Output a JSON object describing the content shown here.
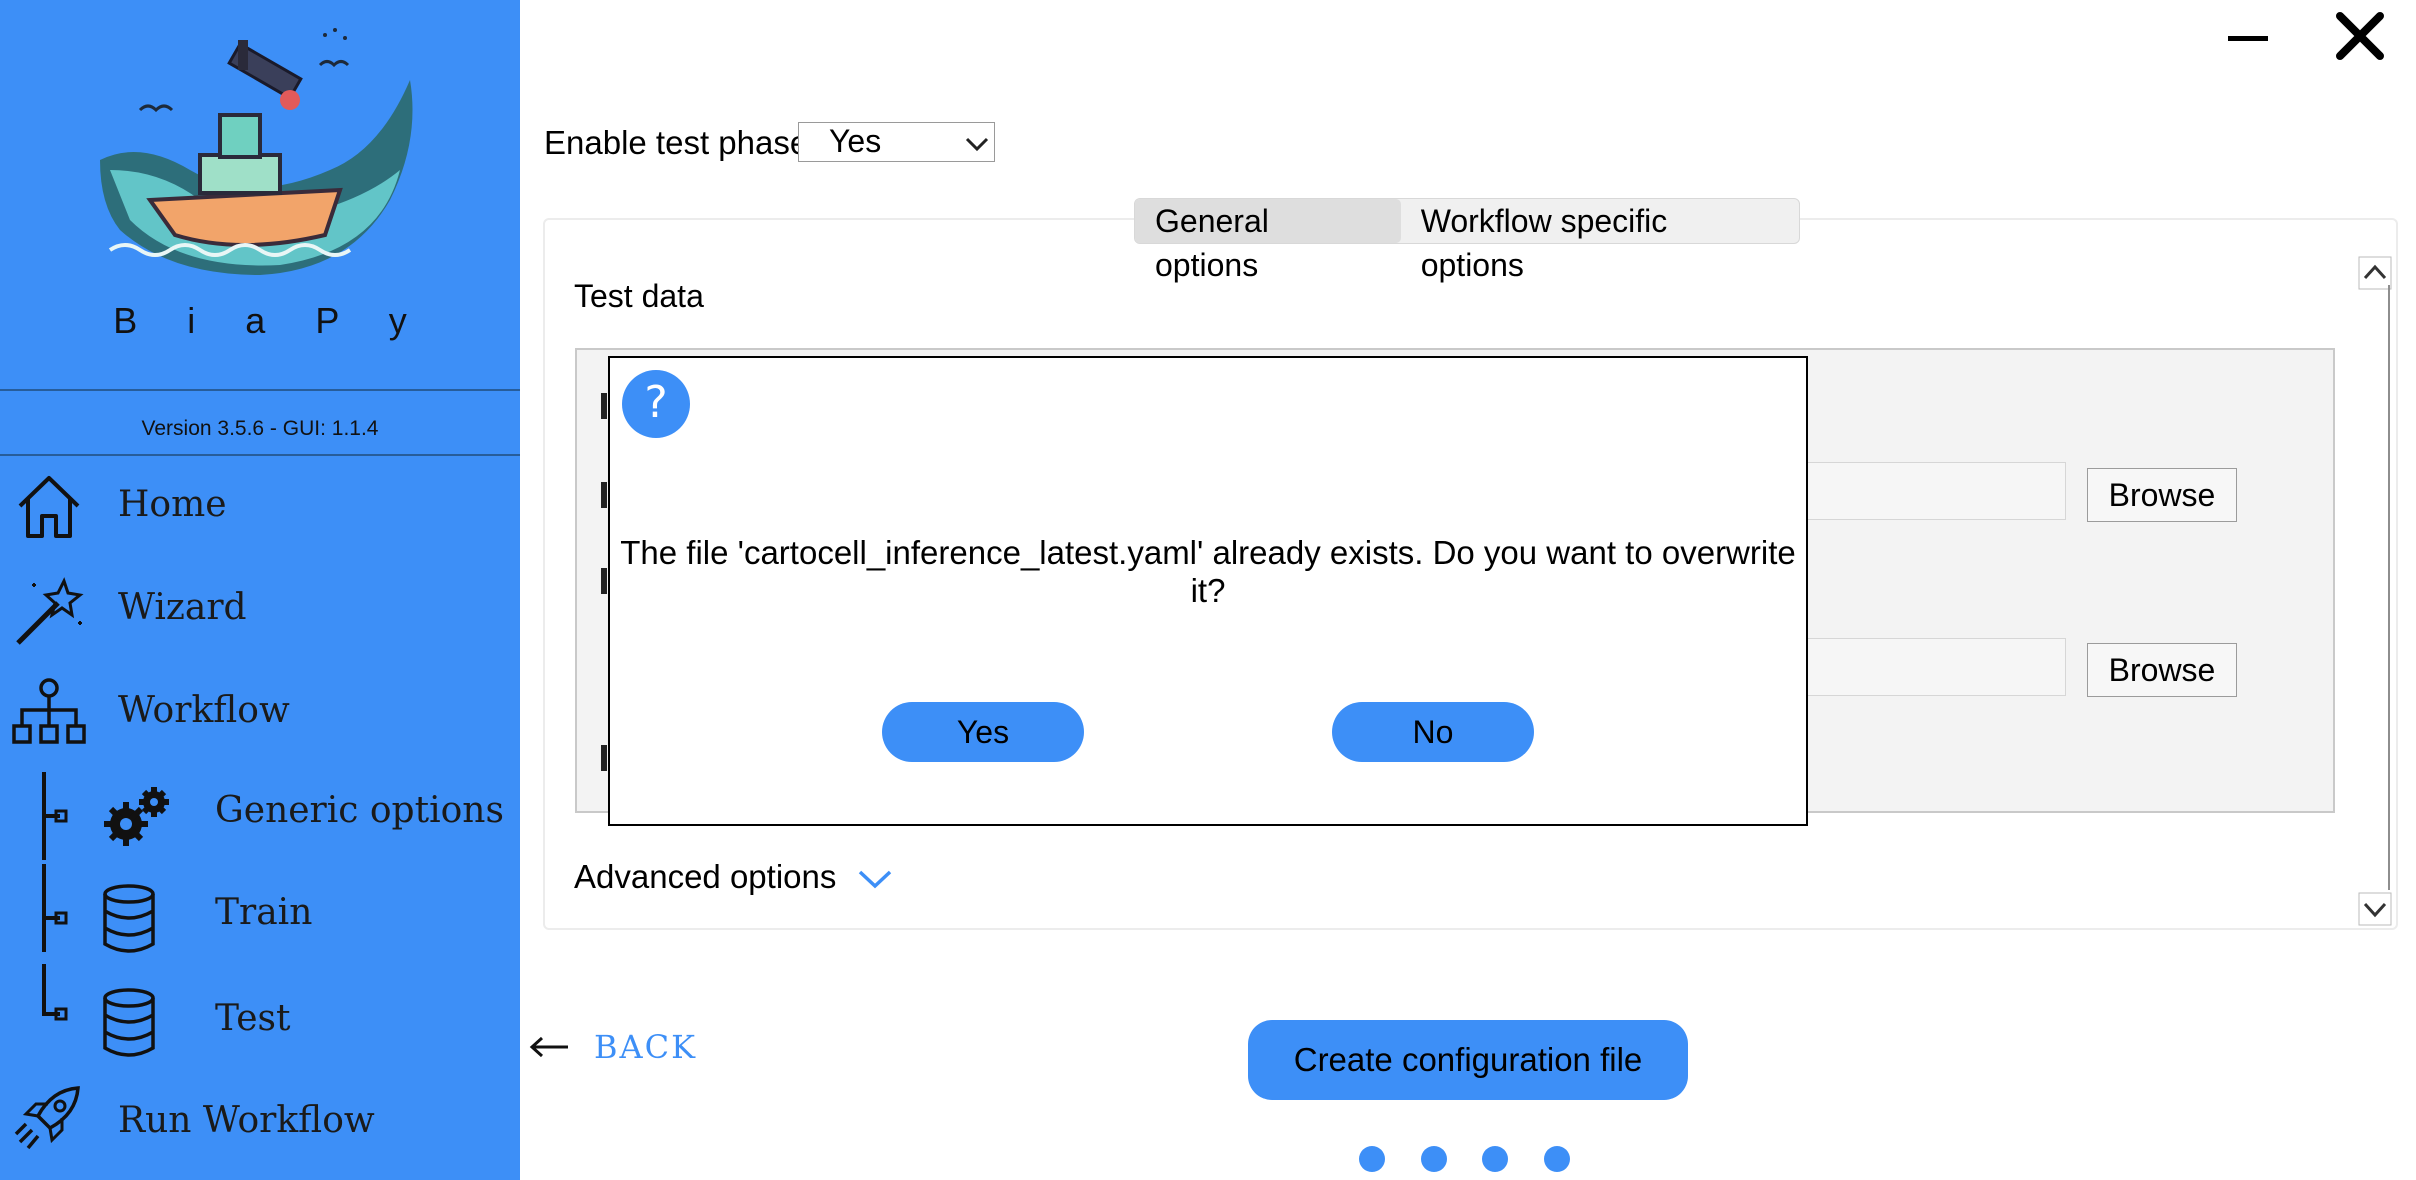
{
  "sidebar": {
    "brand": "B i a P y",
    "version": "Version 3.5.6 - GUI: 1.1.4",
    "items": [
      {
        "label": "Home",
        "icon": "home-icon"
      },
      {
        "label": "Wizard",
        "icon": "magic-wand-icon"
      },
      {
        "label": "Workflow",
        "icon": "workflow-tree-icon"
      },
      {
        "label": "Generic options",
        "icon": "gears-icon"
      },
      {
        "label": "Train",
        "icon": "database-icon"
      },
      {
        "label": "Test",
        "icon": "database-icon"
      },
      {
        "label": "Run Workflow",
        "icon": "rocket-icon"
      }
    ]
  },
  "window_controls": {
    "minimize": "minimize-icon",
    "close": "close-icon"
  },
  "main": {
    "enable_test_label": "Enable test phase",
    "enable_test_value": "Yes",
    "tabs": [
      {
        "label": "General options",
        "active": true
      },
      {
        "label": "Workflow specific options",
        "active": false
      }
    ],
    "section_title": "Test data",
    "browse_label": "Browse",
    "advanced_label": "Advanced options",
    "back_label": "BACK",
    "create_label": "Create configuration file",
    "page_dots": 4
  },
  "dialog": {
    "icon": "question-icon",
    "icon_text": "?",
    "message": "The file 'cartocell_inference_latest.yaml' already exists. Do you want to overwrite it?",
    "yes_label": "Yes",
    "no_label": "No"
  },
  "colors": {
    "accent": "#3d8ff7",
    "sidebar_bg": "#3d8ff7",
    "panel_bg": "#f3f3f3"
  }
}
